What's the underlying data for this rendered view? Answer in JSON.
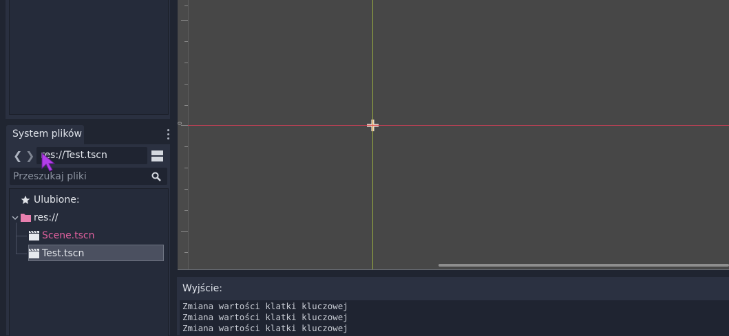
{
  "filesystem": {
    "tab_label": "System plików",
    "back_arrow": "❮",
    "forward_arrow": "❯",
    "path_value": "res://Test.tscn",
    "search_placeholder": "Przeszukaj pliki",
    "icons": [
      "menu-dots-icon",
      "split-view-icon",
      "search-icon",
      "star-icon",
      "folder-icon",
      "scene-file-icon"
    ],
    "tree": {
      "favorites_label": "Ulubione:",
      "root_label": "res://",
      "files": [
        {
          "label": "Scene.tscn",
          "color": "#e0609d"
        },
        {
          "label": "Test.tscn",
          "color": "#e6e9ee",
          "selected": true
        }
      ]
    }
  },
  "viewport": {
    "ruler_zero_label": "0",
    "x_axis_color": "#c04055",
    "y_axis_color": "#93a640"
  },
  "output": {
    "title": "Wyjście:",
    "lines": [
      "Zmiana wartości klatki kluczowej",
      "Zmiana wartości klatki kluczowej",
      "Zmiana wartości klatki kluczowej"
    ]
  },
  "colors": {
    "background": "#202531",
    "panel": "#2b3141",
    "accent_cursor": "#b23ee8"
  }
}
